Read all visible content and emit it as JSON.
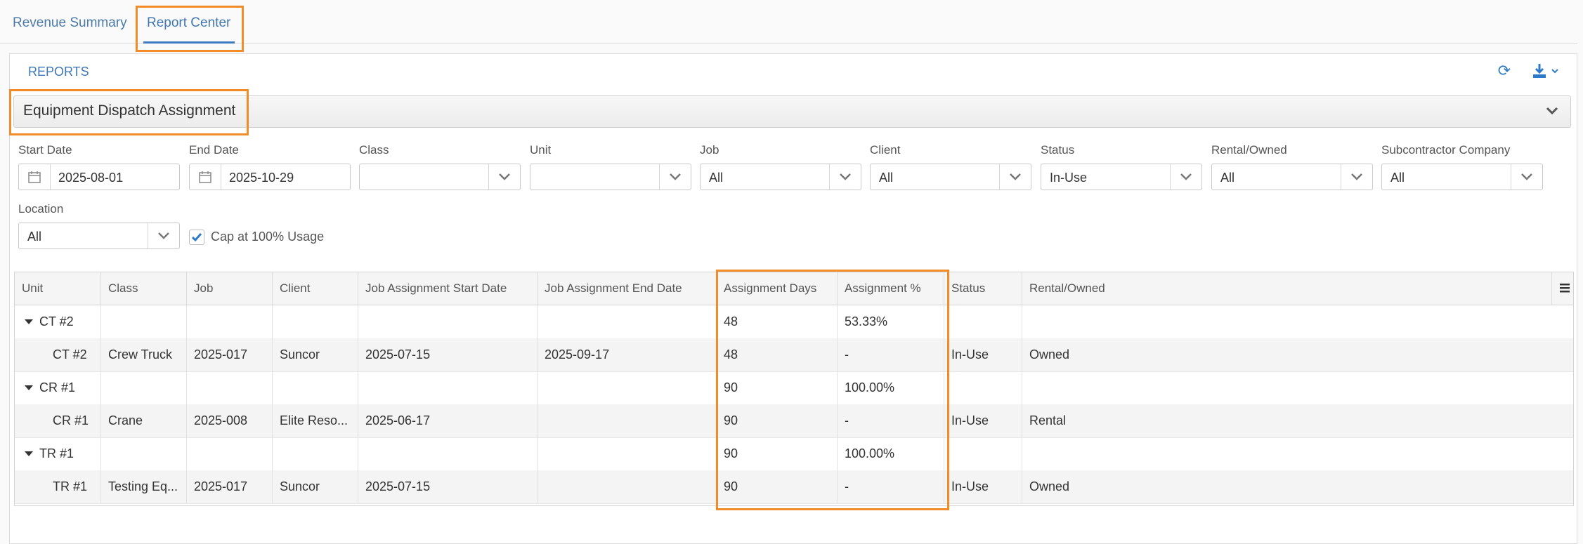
{
  "tabs": [
    {
      "label": "Revenue Summary"
    },
    {
      "label": "Report Center"
    }
  ],
  "panel": {
    "title": "REPORTS"
  },
  "report": {
    "selected": "Equipment Dispatch Assignment"
  },
  "filters": {
    "start_date": {
      "label": "Start Date",
      "value": "2025-08-01"
    },
    "end_date": {
      "label": "End Date",
      "value": "2025-10-29"
    },
    "class": {
      "label": "Class",
      "value": ""
    },
    "unit": {
      "label": "Unit",
      "value": ""
    },
    "job": {
      "label": "Job",
      "value": "All"
    },
    "client": {
      "label": "Client",
      "value": "All"
    },
    "status": {
      "label": "Status",
      "value": "In-Use"
    },
    "rental_owned": {
      "label": "Rental/Owned",
      "value": "All"
    },
    "subcontractor": {
      "label": "Subcontractor Company",
      "value": "All"
    },
    "location": {
      "label": "Location",
      "value": "All"
    },
    "cap": {
      "label": "Cap at 100% Usage",
      "checked": true
    }
  },
  "table": {
    "columns": [
      "Unit",
      "Class",
      "Job",
      "Client",
      "Job Assignment Start Date",
      "Job Assignment End Date",
      "Assignment Days",
      "Assignment %",
      "Status",
      "Rental/Owned"
    ],
    "rows": [
      {
        "group": true,
        "unit": "CT #2",
        "class": "",
        "job": "",
        "client": "",
        "start": "",
        "end": "",
        "days": "48",
        "pct": "53.33%",
        "status": "",
        "rental": ""
      },
      {
        "group": false,
        "unit": "CT #2",
        "class": "Crew Truck",
        "job": "2025-017",
        "client": "Suncor",
        "start": "2025-07-15",
        "end": "2025-09-17",
        "days": "48",
        "pct": "-",
        "status": "In-Use",
        "rental": "Owned"
      },
      {
        "group": true,
        "unit": "CR #1",
        "class": "",
        "job": "",
        "client": "",
        "start": "",
        "end": "",
        "days": "90",
        "pct": "100.00%",
        "status": "",
        "rental": ""
      },
      {
        "group": false,
        "unit": "CR #1",
        "class": "Crane",
        "job": "2025-008",
        "client": "Elite Reso...",
        "start": "2025-06-17",
        "end": "",
        "days": "90",
        "pct": "-",
        "status": "In-Use",
        "rental": "Rental"
      },
      {
        "group": true,
        "unit": "TR #1",
        "class": "",
        "job": "",
        "client": "",
        "start": "",
        "end": "",
        "days": "90",
        "pct": "100.00%",
        "status": "",
        "rental": ""
      },
      {
        "group": false,
        "unit": "TR #1",
        "class": "Testing Eq...",
        "job": "2025-017",
        "client": "Suncor",
        "start": "2025-07-15",
        "end": "",
        "days": "90",
        "pct": "-",
        "status": "In-Use",
        "rental": "Owned"
      }
    ]
  },
  "colors": {
    "accent": "#3b7dc0",
    "highlight": "#f28c28"
  }
}
